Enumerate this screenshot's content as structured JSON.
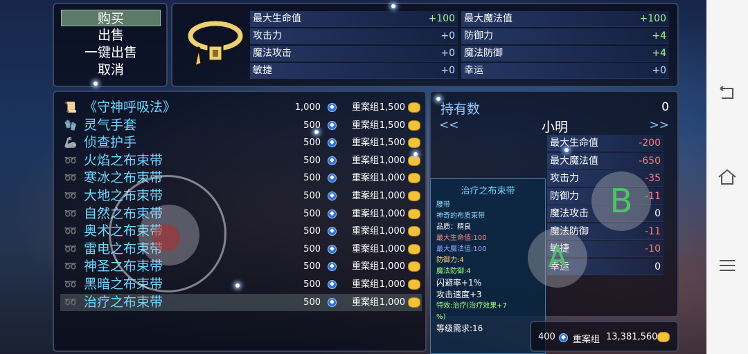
{
  "command_menu": {
    "items": [
      "购买",
      "出售",
      "一键出售",
      "取消"
    ],
    "selected_index": 0
  },
  "item_stats": {
    "rows": [
      {
        "label": "最大生命值",
        "value": "+100"
      },
      {
        "label": "最大魔法值",
        "value": "+100"
      },
      {
        "label": "攻击力",
        "value": "+0"
      },
      {
        "label": "防御力",
        "value": "+4"
      },
      {
        "label": "魔法攻击",
        "value": "+0"
      },
      {
        "label": "魔法防御",
        "value": "+4"
      },
      {
        "label": "敏捷",
        "value": "+0"
      },
      {
        "label": "幸运",
        "value": "+0"
      }
    ]
  },
  "shop": {
    "currency_name": "重案组",
    "items": [
      {
        "icon": "scroll-icon",
        "name": "《守神呼吸法》",
        "price": "1,000",
        "cost": "1,500"
      },
      {
        "icon": "glove-icon",
        "name": "灵气手套",
        "price": "500",
        "cost": "1,500"
      },
      {
        "icon": "bracer-icon",
        "name": "侦查护手",
        "price": "500",
        "cost": "1,500"
      },
      {
        "icon": "belt-icon",
        "name": "火焰之布束带",
        "price": "500",
        "cost": "1,000"
      },
      {
        "icon": "belt-icon",
        "name": "寒冰之布束带",
        "price": "500",
        "cost": "1,000"
      },
      {
        "icon": "belt-icon",
        "name": "大地之布束带",
        "price": "500",
        "cost": "1,000"
      },
      {
        "icon": "belt-icon",
        "name": "自然之布束带",
        "price": "500",
        "cost": "1,000"
      },
      {
        "icon": "belt-icon",
        "name": "奥术之布束带",
        "price": "500",
        "cost": "1,000"
      },
      {
        "icon": "belt-icon",
        "name": "雷电之布束带",
        "price": "500",
        "cost": "1,000"
      },
      {
        "icon": "belt-icon",
        "name": "神圣之布束带",
        "price": "500",
        "cost": "1,000"
      },
      {
        "icon": "belt-icon",
        "name": "黑暗之布束带",
        "price": "500",
        "cost": "1,000"
      },
      {
        "icon": "belt-icon",
        "name": "治疗之布束带",
        "price": "500",
        "cost": "1,000"
      }
    ],
    "selected_index": 11
  },
  "info": {
    "owned_label": "持有数",
    "owned_value": "0",
    "nav_left": "<<",
    "nav_right": ">>",
    "character_name": "小明",
    "stats": [
      {
        "label": "最大生命值",
        "value": "-200"
      },
      {
        "label": "最大魔法值",
        "value": "-650"
      },
      {
        "label": "攻击力",
        "value": "-35"
      },
      {
        "label": "防御力",
        "value": "-11"
      },
      {
        "label": "魔法攻击",
        "value": "0"
      },
      {
        "label": "魔法防御",
        "value": "-11"
      },
      {
        "label": "敏捷",
        "value": "-10"
      },
      {
        "label": "幸运",
        "value": "0"
      }
    ]
  },
  "tooltip": {
    "title": "治疗之布束带",
    "lines": [
      {
        "text": "腰带",
        "style": "c"
      },
      {
        "text": "神奇的布质束带",
        "style": "c"
      },
      {
        "text": "品质：精良",
        "style": "w"
      },
      {
        "text": "最大生命值:100",
        "style": "r"
      },
      {
        "text": "最大魔法值:100",
        "style": "b"
      },
      {
        "text": "防御力:4",
        "style": "y"
      },
      {
        "text": "魔法防御:4",
        "style": "g"
      },
      {
        "text": "闪避率+1%",
        "style": "big"
      },
      {
        "text": "攻击速度+3",
        "style": "big"
      },
      {
        "text": "特效:治疗(治疗效果+7",
        "style": "g"
      },
      {
        "text": "%)",
        "style": "g"
      },
      {
        "text": "等级需求:16",
        "style": "big"
      }
    ]
  },
  "money": {
    "price": "400",
    "currency_name": "重案组",
    "gold": "13,381,560"
  },
  "controls": {
    "button_b": "B",
    "button_a": "A"
  },
  "android_nav": {
    "back_icon": "back-icon",
    "home_icon": "home-icon",
    "menu_icon": "menu-icon"
  }
}
